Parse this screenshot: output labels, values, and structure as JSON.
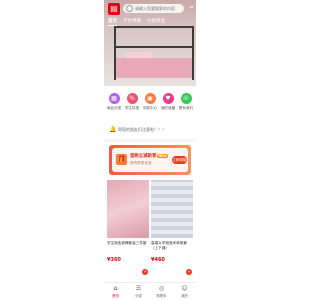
{
  "header": {
    "logo_text": "▤",
    "search_placeholder": "请输入您要搜索的内容",
    "scan_icon": "scan-icon"
  },
  "tabs": [
    {
      "label": "首页"
    },
    {
      "label": "学生特惠"
    },
    {
      "label": "分类商品"
    }
  ],
  "quick_entries": [
    {
      "label": "商品分类",
      "icon": "grid-icon",
      "color": "#b460e8"
    },
    {
      "label": "学生特惠",
      "icon": "discount-icon",
      "color": "#f0506e"
    },
    {
      "label": "领券中心",
      "icon": "coupon-icon",
      "color": "#ff7a3c"
    },
    {
      "label": "我的收藏",
      "icon": "heart-icon",
      "color": "#ee3a8c"
    },
    {
      "label": "联系我们",
      "icon": "phone-icon",
      "color": "#34c759"
    }
  ],
  "notice": {
    "icon": "bell-icon",
    "text": "寄宿的朋友们注意啦！！！"
  },
  "coupon": {
    "title": "首购立减新享",
    "badge": "NEW",
    "subtitle": "首购享受优惠",
    "button": "立即领取"
  },
  "goods": [
    {
      "name": "学生宿舍被褥套装三件套",
      "price": "¥360",
      "color": "#e3aab2"
    },
    {
      "name": "高端大学宿舍床单被套（上下铺）",
      "price": "¥460",
      "color": "#cfd2dd"
    }
  ],
  "bottom_nav": [
    {
      "label": "首页",
      "icon": "home-icon",
      "glyph": "⌂",
      "active": true
    },
    {
      "label": "分类",
      "icon": "category-icon",
      "glyph": "☰",
      "active": false
    },
    {
      "label": "购物车",
      "icon": "cart-icon",
      "glyph": "◎",
      "active": false
    },
    {
      "label": "我的",
      "icon": "user-icon",
      "glyph": "☺",
      "active": false
    }
  ]
}
